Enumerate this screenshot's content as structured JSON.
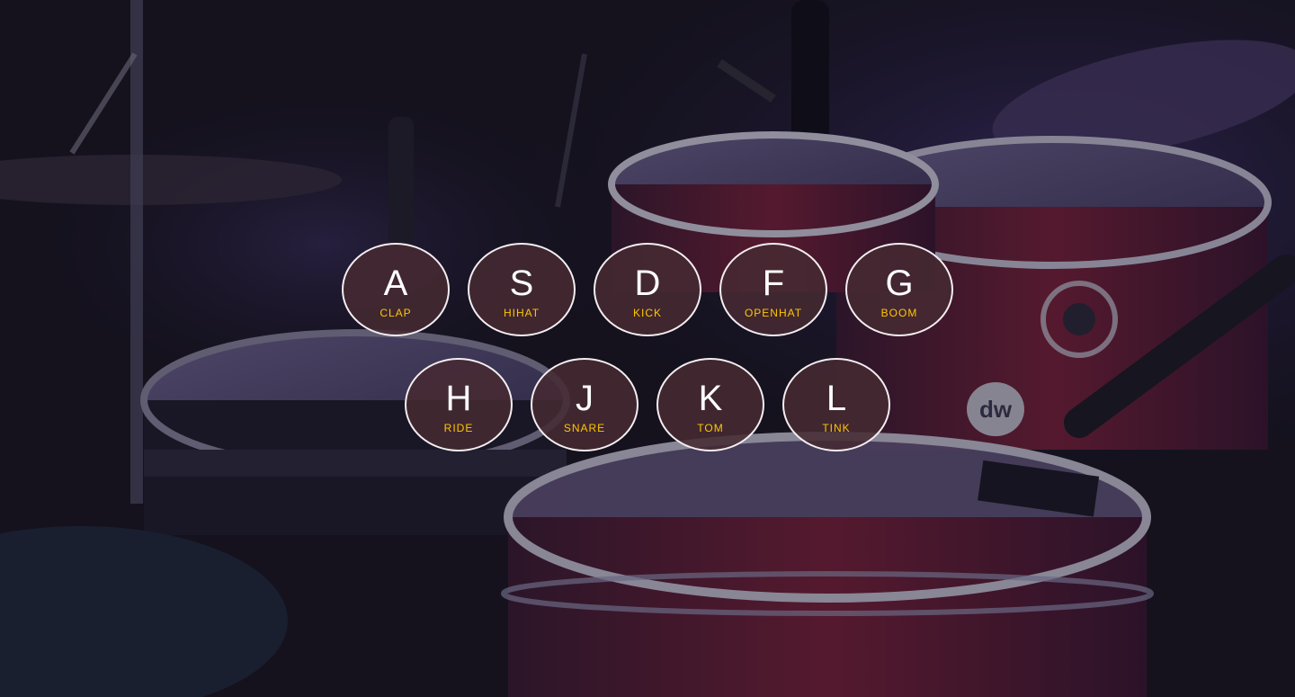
{
  "colors": {
    "key_letter": "#ffffff",
    "sound_label": "#ffc600",
    "key_border": "#f3eef0",
    "key_fill": "#462a32"
  },
  "background": {
    "icon": "drum-kit-photo",
    "logo_text": "dw"
  },
  "keys": [
    {
      "letter": "A",
      "sound": "CLAP"
    },
    {
      "letter": "S",
      "sound": "HIHAT"
    },
    {
      "letter": "D",
      "sound": "KICK"
    },
    {
      "letter": "F",
      "sound": "OPENHAT"
    },
    {
      "letter": "G",
      "sound": "BOOM"
    },
    {
      "letter": "H",
      "sound": "RIDE"
    },
    {
      "letter": "J",
      "sound": "SNARE"
    },
    {
      "letter": "K",
      "sound": "TOM"
    },
    {
      "letter": "L",
      "sound": "TINK"
    }
  ]
}
